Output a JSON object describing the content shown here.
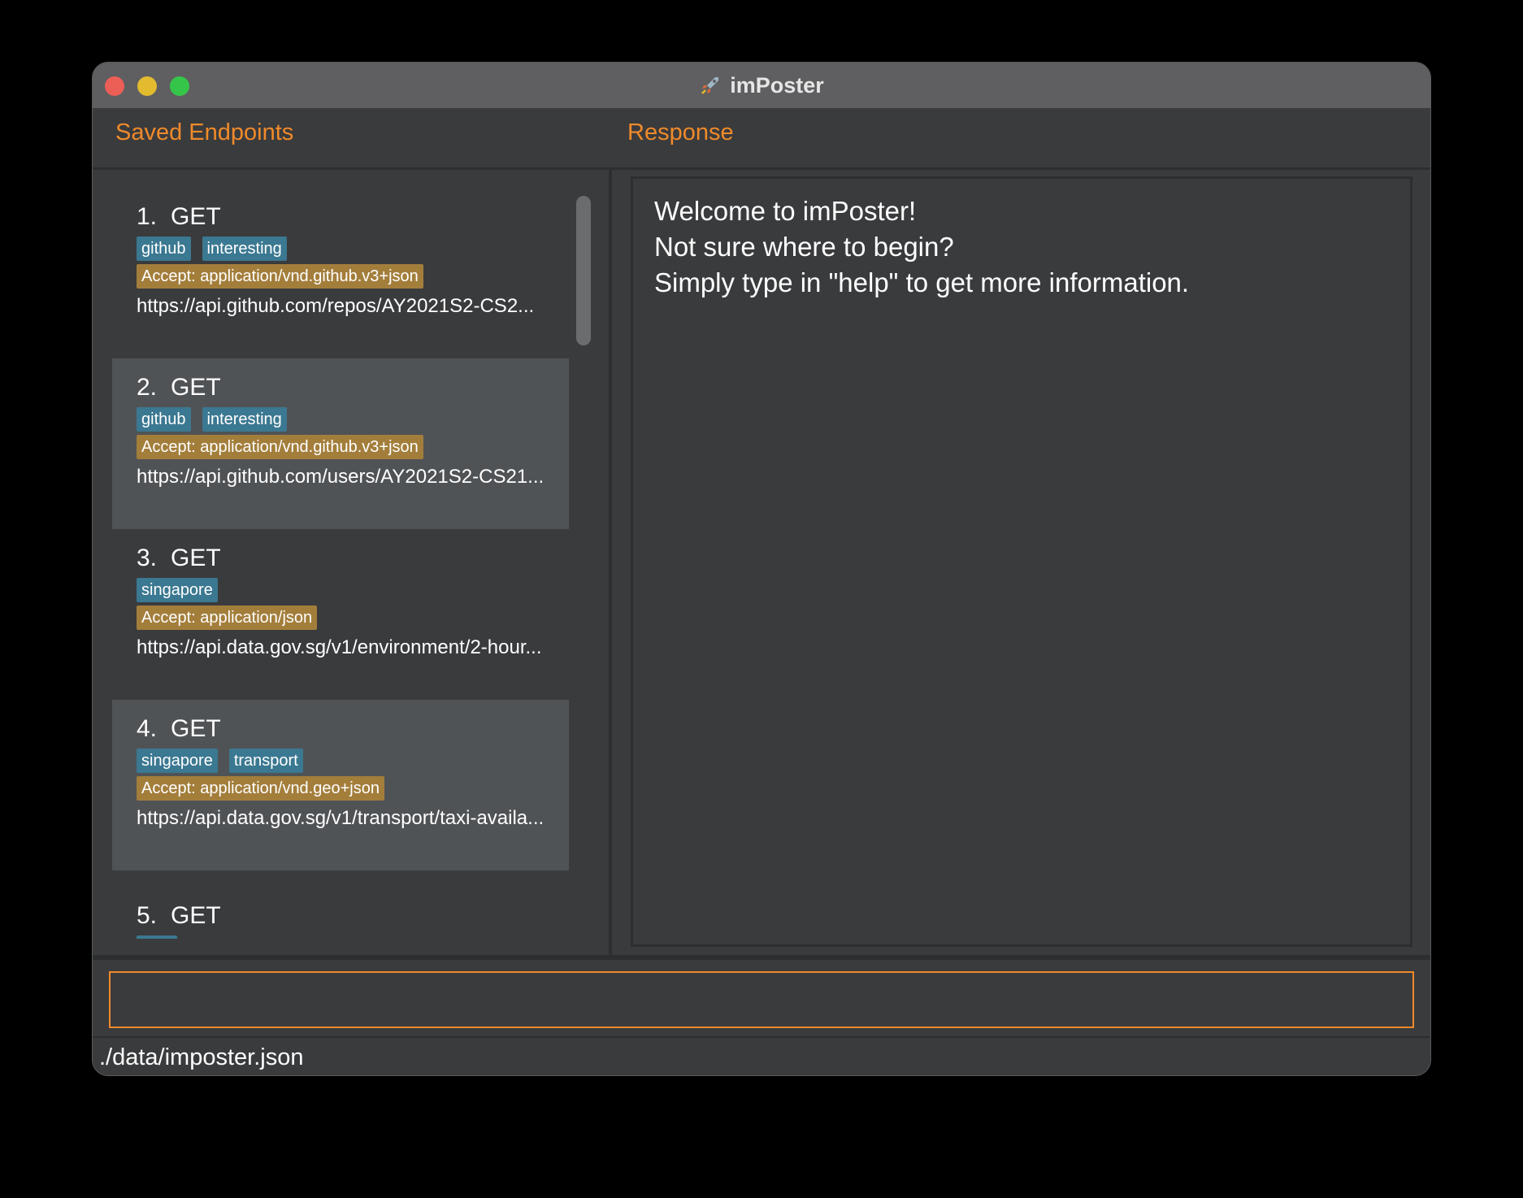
{
  "window": {
    "title": "imPoster",
    "app_icon": "rocket-launch-icon"
  },
  "colors": {
    "accent": "#ef8a2a",
    "tag_bg": "#3b7891",
    "header_badge_bg": "#a37e3b",
    "window_bg": "#3a3b3d",
    "selected_item_bg": "#505356"
  },
  "panels": {
    "saved_endpoints_title": "Saved Endpoints",
    "response_title": "Response"
  },
  "endpoints": [
    {
      "index": "1.",
      "method": "GET",
      "tags": [
        "github",
        "interesting"
      ],
      "header": "Accept: application/vnd.github.v3+json",
      "url": "https://api.github.com/repos/AY2021S2-CS2..."
    },
    {
      "index": "2.",
      "method": "GET",
      "tags": [
        "github",
        "interesting"
      ],
      "header": "Accept: application/vnd.github.v3+json",
      "url": "https://api.github.com/users/AY2021S2-CS21..."
    },
    {
      "index": "3.",
      "method": "GET",
      "tags": [
        "singapore"
      ],
      "header": "Accept: application/json",
      "url": "https://api.data.gov.sg/v1/environment/2-hour..."
    },
    {
      "index": "4.",
      "method": "GET",
      "tags": [
        "singapore",
        "transport"
      ],
      "header": "Accept: application/vnd.geo+json",
      "url": "https://api.data.gov.sg/v1/transport/taxi-availa..."
    },
    {
      "index": "5.",
      "method": "GET",
      "tags": [],
      "header": "",
      "url": ""
    }
  ],
  "response": {
    "lines": [
      "Welcome to imPoster!",
      "Not sure where to begin?",
      "Simply type in \"help\" to get more information."
    ]
  },
  "command": {
    "value": "",
    "placeholder": ""
  },
  "status": {
    "file_path": "./data/imposter.json"
  }
}
